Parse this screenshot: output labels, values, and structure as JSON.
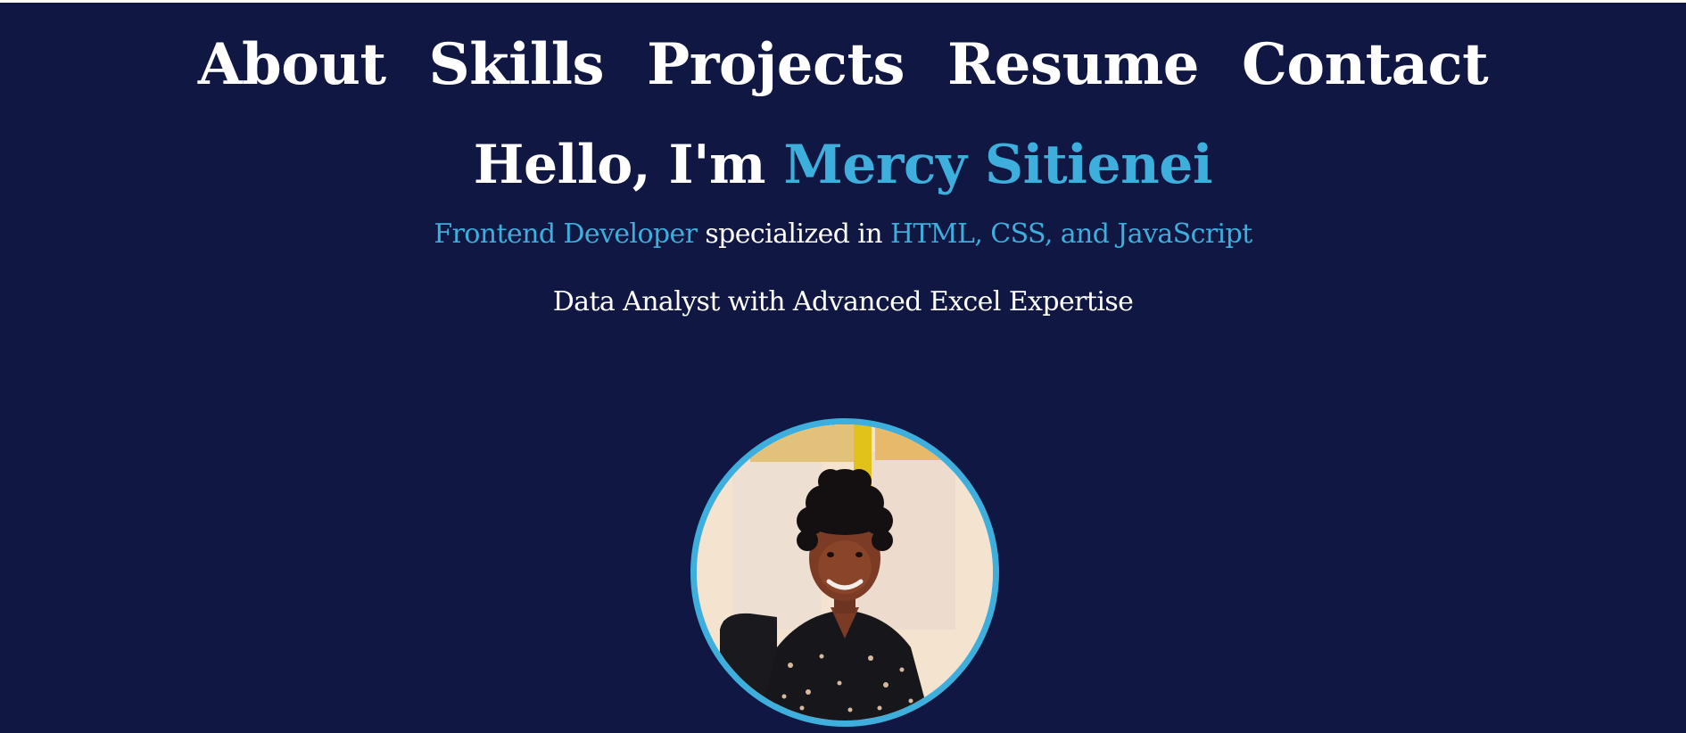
{
  "nav": {
    "items": [
      "About",
      "Skills",
      "Projects",
      "Resume",
      "Contact"
    ]
  },
  "hero": {
    "greeting_prefix": "Hello, I'm ",
    "name": "Mercy Sitienei",
    "role": "Frontend Developer",
    "role_connector": " specialized in ",
    "technologies": "HTML, CSS, and JavaScript",
    "subtitle": "Data Analyst with Advanced Excel Expertise"
  },
  "colors": {
    "background": "#0f1742",
    "accent": "#3eaedc",
    "text": "#ffffff"
  }
}
